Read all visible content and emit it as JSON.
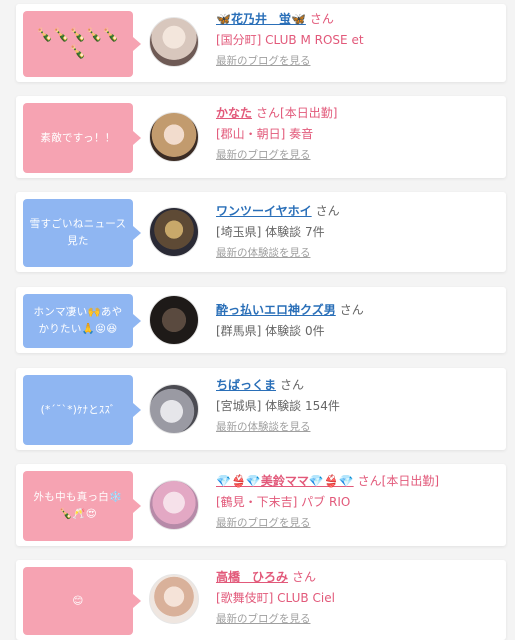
{
  "accent_pink": "#e2597a",
  "accent_blue": "#2a6fb8",
  "entries": [
    {
      "message": "🍾🍾🍾🍾🍾🍾",
      "name": "🦋花乃井　蛍🦋",
      "honorific": "さん",
      "line2": "[国分町] CLUB M ROSE et",
      "link": "最新のブログを見る",
      "type": "cast"
    },
    {
      "message": "素敵ですっ！！",
      "name": "かなた",
      "honorific": "さん[本日出勤]",
      "line2": "[郡山・朝日] 奏音",
      "link": "最新のブログを見る",
      "type": "cast"
    },
    {
      "message": "雪すごいねニュース見た",
      "name": "ワンツーイヤホイ",
      "honorific": "さん",
      "line2": "[埼玉県] 体験談 7件",
      "link": "最新の体験談を見る",
      "type": "user"
    },
    {
      "message": "ホンマ凄い🙌あやかりたい🙏😝😆",
      "name": "酔っ払いエロ神クズ男",
      "honorific": "さん",
      "line2": "[群馬県] 体験談 0件",
      "link": "",
      "type": "user"
    },
    {
      "message": "(*´˘`*)ｹﾅとｽｽﾞ",
      "name": "ちばっくま",
      "honorific": "さん",
      "line2": "[宮城県] 体験談 154件",
      "link": "最新の体験談を見る",
      "type": "user"
    },
    {
      "message": "外も中も真っ白❄️🍾🥂😍",
      "name": "💎👙💎美鈴ママ💎👙💎",
      "honorific": "さん[本日出勤]",
      "line2": "[鶴見・下末吉] パブ RIO",
      "link": "最新のブログを見る",
      "type": "cast"
    },
    {
      "message": "😊",
      "name": "高橋　ひろみ",
      "honorific": "さん",
      "line2": "[歌舞伎町] CLUB Ciel",
      "link": "最新のブログを見る",
      "type": "cast"
    }
  ]
}
